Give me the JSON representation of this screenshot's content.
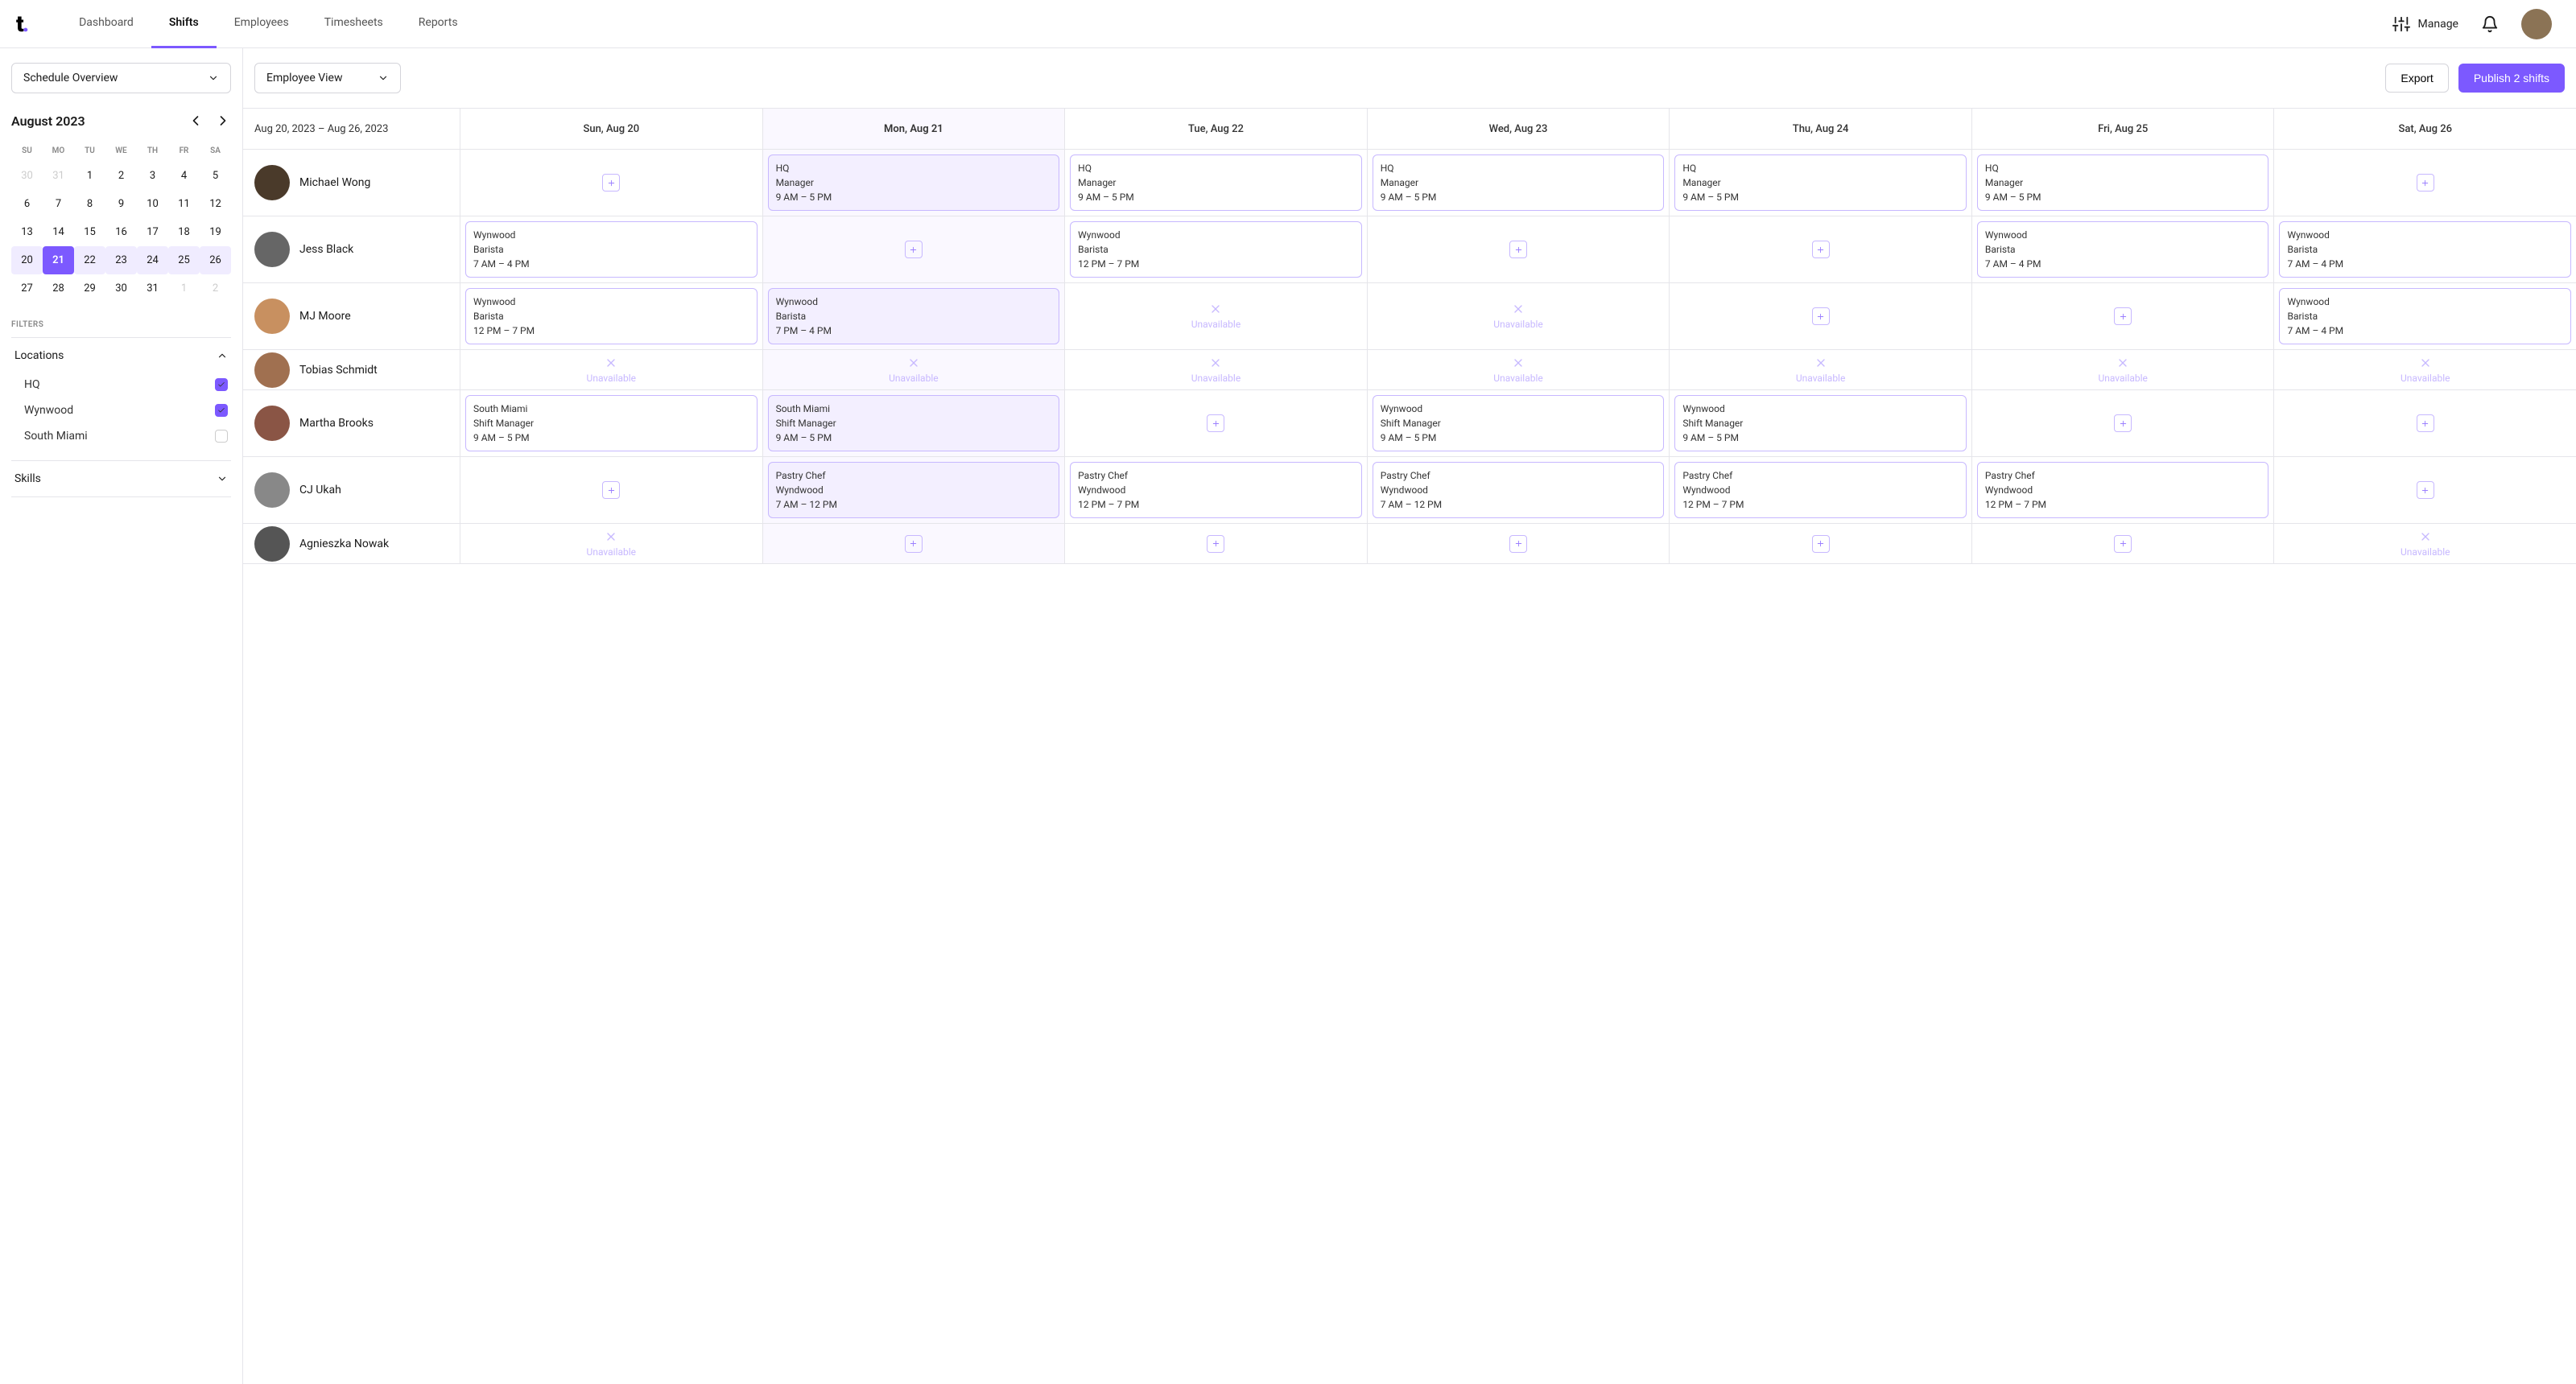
{
  "nav": {
    "items": [
      {
        "label": "Dashboard"
      },
      {
        "label": "Shifts",
        "active": true
      },
      {
        "label": "Employees"
      },
      {
        "label": "Timesheets"
      },
      {
        "label": "Reports"
      }
    ],
    "manage": "Manage"
  },
  "sidebar": {
    "schedule_dropdown": "Schedule Overview",
    "cal": {
      "title": "August 2023",
      "dow": [
        "SU",
        "MO",
        "TU",
        "WE",
        "TH",
        "FR",
        "SA"
      ],
      "days": [
        {
          "n": "30",
          "muted": true
        },
        {
          "n": "31",
          "muted": true
        },
        {
          "n": "1"
        },
        {
          "n": "2"
        },
        {
          "n": "3"
        },
        {
          "n": "4"
        },
        {
          "n": "5"
        },
        {
          "n": "6"
        },
        {
          "n": "7"
        },
        {
          "n": "8"
        },
        {
          "n": "9"
        },
        {
          "n": "10"
        },
        {
          "n": "11"
        },
        {
          "n": "12"
        },
        {
          "n": "13"
        },
        {
          "n": "14"
        },
        {
          "n": "15"
        },
        {
          "n": "16"
        },
        {
          "n": "17"
        },
        {
          "n": "18"
        },
        {
          "n": "19"
        },
        {
          "n": "20",
          "week": true
        },
        {
          "n": "21",
          "week": true,
          "selected": true
        },
        {
          "n": "22",
          "week": true
        },
        {
          "n": "23",
          "week": true
        },
        {
          "n": "24",
          "week": true
        },
        {
          "n": "25",
          "week": true
        },
        {
          "n": "26",
          "week": true
        },
        {
          "n": "27"
        },
        {
          "n": "28"
        },
        {
          "n": "29"
        },
        {
          "n": "30"
        },
        {
          "n": "31"
        },
        {
          "n": "1",
          "muted": true
        },
        {
          "n": "2",
          "muted": true
        }
      ]
    },
    "filters_label": "FILTERS",
    "locations": {
      "label": "Locations",
      "items": [
        {
          "label": "HQ",
          "checked": true
        },
        {
          "label": "Wynwood",
          "checked": true
        },
        {
          "label": "South Miami",
          "checked": false
        }
      ]
    },
    "skills_label": "Skills"
  },
  "toolbar": {
    "view_dropdown": "Employee View",
    "export": "Export",
    "publish": "Publish 2 shifts"
  },
  "schedule": {
    "range": "Aug 20, 2023 – Aug 26, 2023",
    "days": [
      {
        "label": "Sun, Aug 20"
      },
      {
        "label": "Mon, Aug 21",
        "today": true
      },
      {
        "label": "Tue, Aug 22"
      },
      {
        "label": "Wed, Aug 23"
      },
      {
        "label": "Thu, Aug 24"
      },
      {
        "label": "Fri, Aug 25"
      },
      {
        "label": "Sat, Aug 26"
      }
    ],
    "unavailable_label": "Unavailable",
    "employees": [
      {
        "name": "Michael Wong",
        "avatar": "#4a3a2a",
        "cells": [
          {
            "type": "add"
          },
          {
            "type": "shift",
            "l1": "HQ",
            "l2": "Manager",
            "l3": "9 AM – 5 PM",
            "highlight": true
          },
          {
            "type": "shift",
            "l1": "HQ",
            "l2": "Manager",
            "l3": "9 AM – 5 PM"
          },
          {
            "type": "shift",
            "l1": "HQ",
            "l2": "Manager",
            "l3": "9 AM – 5 PM"
          },
          {
            "type": "shift",
            "l1": "HQ",
            "l2": "Manager",
            "l3": "9 AM – 5 PM"
          },
          {
            "type": "shift",
            "l1": "HQ",
            "l2": "Manager",
            "l3": "9 AM – 5 PM"
          },
          {
            "type": "add"
          }
        ]
      },
      {
        "name": "Jess Black",
        "avatar": "#666",
        "cells": [
          {
            "type": "shift",
            "l1": "Wynwood",
            "l2": "Barista",
            "l3": "7 AM – 4 PM"
          },
          {
            "type": "add"
          },
          {
            "type": "shift",
            "l1": "Wynwood",
            "l2": "Barista",
            "l3": "12 PM – 7 PM"
          },
          {
            "type": "add"
          },
          {
            "type": "add"
          },
          {
            "type": "shift",
            "l1": "Wynwood",
            "l2": "Barista",
            "l3": "7 AM – 4 PM"
          },
          {
            "type": "shift",
            "l1": "Wynwood",
            "l2": "Barista",
            "l3": "7 AM – 4 PM"
          }
        ]
      },
      {
        "name": "MJ Moore",
        "avatar": "#c89060",
        "cells": [
          {
            "type": "shift",
            "l1": "Wynwood",
            "l2": "Barista",
            "l3": "12 PM – 7 PM"
          },
          {
            "type": "shift",
            "l1": "Wynwood",
            "l2": "Barista",
            "l3": "7 PM – 4 PM",
            "highlight": true
          },
          {
            "type": "unavail"
          },
          {
            "type": "unavail"
          },
          {
            "type": "add"
          },
          {
            "type": "add"
          },
          {
            "type": "shift",
            "l1": "Wynwood",
            "l2": "Barista",
            "l3": "7 AM – 4 PM"
          }
        ]
      },
      {
        "name": "Tobias Schmidt",
        "avatar": "#a07050",
        "cells": [
          {
            "type": "unavail"
          },
          {
            "type": "unavail"
          },
          {
            "type": "unavail"
          },
          {
            "type": "unavail"
          },
          {
            "type": "unavail"
          },
          {
            "type": "unavail"
          },
          {
            "type": "unavail"
          }
        ]
      },
      {
        "name": "Martha Brooks",
        "avatar": "#8a5545",
        "cells": [
          {
            "type": "shift",
            "l1": "South Miami",
            "l2": "Shift Manager",
            "l3": "9 AM – 5 PM"
          },
          {
            "type": "shift",
            "l1": "South Miami",
            "l2": "Shift Manager",
            "l3": "9 AM – 5 PM",
            "highlight": true
          },
          {
            "type": "add"
          },
          {
            "type": "shift",
            "l1": "Wynwood",
            "l2": "Shift Manager",
            "l3": "9 AM – 5 PM"
          },
          {
            "type": "shift",
            "l1": "Wynwood",
            "l2": "Shift Manager",
            "l3": "9 AM – 5 PM"
          },
          {
            "type": "add"
          },
          {
            "type": "add"
          }
        ]
      },
      {
        "name": "CJ Ukah",
        "avatar": "#888",
        "cells": [
          {
            "type": "add"
          },
          {
            "type": "shift",
            "l1": "Pastry Chef",
            "l2": "Wyndwood",
            "l3": "7 AM – 12 PM",
            "highlight": true
          },
          {
            "type": "shift",
            "l1": "Pastry Chef",
            "l2": "Wyndwood",
            "l3": "12 PM – 7 PM"
          },
          {
            "type": "shift",
            "l1": "Pastry Chef",
            "l2": "Wyndwood",
            "l3": "7 AM – 12 PM"
          },
          {
            "type": "shift",
            "l1": "Pastry Chef",
            "l2": "Wyndwood",
            "l3": "12 PM – 7 PM"
          },
          {
            "type": "shift",
            "l1": "Pastry Chef",
            "l2": "Wyndwood",
            "l3": "12 PM – 7 PM"
          },
          {
            "type": "add"
          }
        ]
      },
      {
        "name": "Agnieszka Nowak",
        "avatar": "#555",
        "cells": [
          {
            "type": "unavail"
          },
          {
            "type": "add"
          },
          {
            "type": "add"
          },
          {
            "type": "add"
          },
          {
            "type": "add"
          },
          {
            "type": "add"
          },
          {
            "type": "unavail"
          }
        ]
      }
    ]
  }
}
